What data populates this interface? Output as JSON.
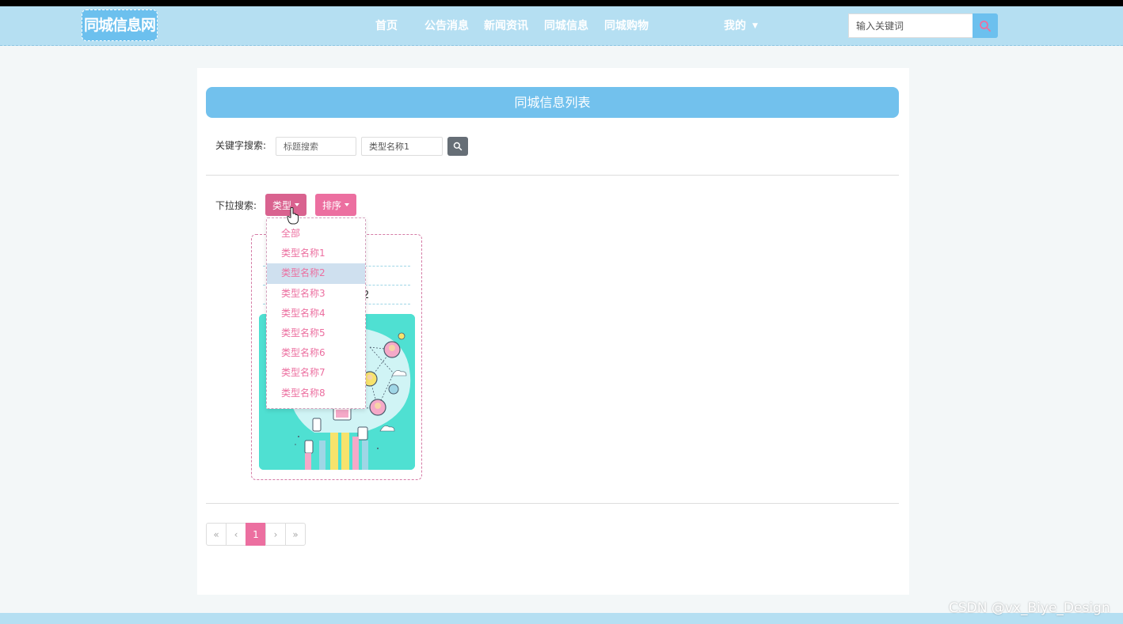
{
  "header": {
    "logo": "同城信息网",
    "nav": [
      "首页",
      "公告消息",
      "新闻资讯",
      "同城信息",
      "同城购物"
    ],
    "mine": "我的",
    "search_placeholder": "输入关键词"
  },
  "page": {
    "title": "同城信息列表",
    "keyword_label": "关键字搜索:",
    "title_search_placeholder": "标题搜索",
    "type_search_value": "类型名称1",
    "dropdown_label": "下拉搜索:",
    "type_button": "类型",
    "sort_button": "排序"
  },
  "dropdown": {
    "items": [
      "全部",
      "类型名称1",
      "类型名称2",
      "类型名称3",
      "类型名称4",
      "类型名称5",
      "类型名称6",
      "类型名称7",
      "类型名称8"
    ],
    "highlighted": "类型名称2"
  },
  "card": {
    "partial_text": "2"
  },
  "pagination": [
    "«",
    "‹",
    "1",
    "›",
    "»"
  ],
  "watermark": "CSDN @vx_Biye_Design",
  "colors": {
    "nav_bg": "#b5dff2",
    "accent_blue": "#72c1ed",
    "accent_pink": "#ec6fa0"
  }
}
